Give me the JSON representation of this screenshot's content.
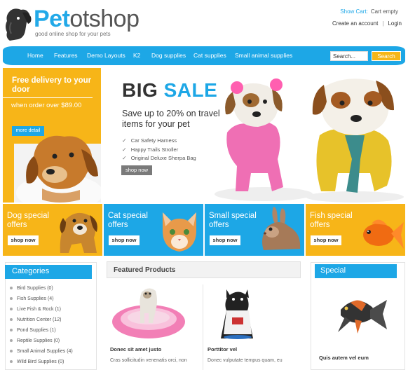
{
  "header": {
    "logo_brand": "Pet",
    "logo_rest": "otshop",
    "tagline": "good online shop for your pets",
    "cart_label": "Show Cart:",
    "cart_value": "Cart empty",
    "create_account": "Create an account",
    "separator": "|",
    "login": "Login"
  },
  "nav": {
    "items": [
      "Home",
      "Features",
      "Demo Layouts",
      "K2",
      "Dog supplies",
      "Cat supplies",
      "Small animal supplies"
    ],
    "search_placeholder": "Search...",
    "search_button": "Search"
  },
  "promo": {
    "title": "Free delivery to your door",
    "subtitle": "when order over $89.00",
    "button": "more detail"
  },
  "sale": {
    "big_1": "BIG",
    "big_2": "SALE",
    "tagline": "Save up to 20% on travel items for your pet",
    "features": [
      "Car Safety Harness",
      "Happy Trails Stroller",
      "Original Deluxe Sherpa Bag"
    ],
    "button": "shop now"
  },
  "tiles": [
    {
      "title": "Dog special offers",
      "button": "shop now",
      "color": "#f7b518"
    },
    {
      "title": "Cat special offers",
      "button": "shop now",
      "color": "#1da7e6"
    },
    {
      "title": "Small special offers",
      "button": "shop now",
      "color": "#1da7e6"
    },
    {
      "title": "Fish special offers",
      "button": "shop now",
      "color": "#f7b518"
    }
  ],
  "categories": {
    "title": "Categories",
    "items": [
      "Bird Supplies (0)",
      "Fish Supplies (4)",
      "Live Fish & Rock (1)",
      "Nutrition Center (12)",
      "Pond Supplies (1)",
      "Reptile Supplies (0)",
      "Small Animal Supplies (4)",
      "Wild Bird Supplies (0)"
    ]
  },
  "featured": {
    "title": "Featured Products",
    "products": [
      {
        "name": "Donec sit amet justo",
        "desc": "Cras sollicitudin venenatis orci, non"
      },
      {
        "name": "Porttitor vel",
        "desc": "Donec vulputate tempus quam, eu"
      }
    ]
  },
  "special": {
    "title": "Special",
    "product_name": "Quis autem vel eum"
  },
  "colors": {
    "accent_blue": "#1da7e6",
    "accent_orange": "#f7b518"
  }
}
